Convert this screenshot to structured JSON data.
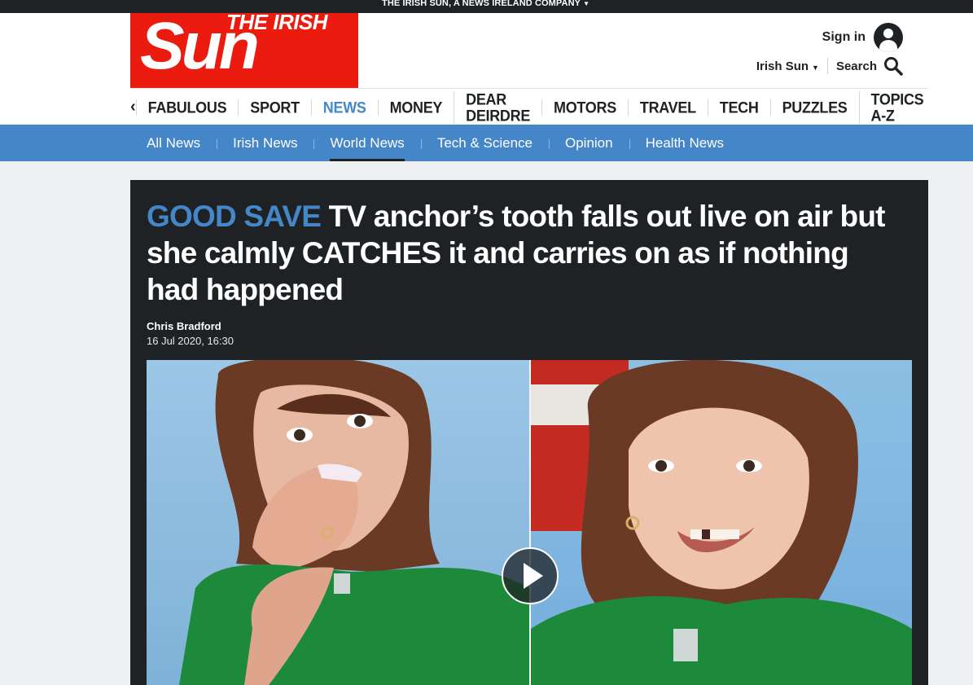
{
  "topbar": {
    "company": "THE IRISH SUN, A NEWS IRELAND COMPANY"
  },
  "logo": {
    "line1": "THE IRISH",
    "line2": "Sun"
  },
  "account": {
    "signin": "Sign in",
    "edition": "Irish Sun",
    "search": "Search"
  },
  "nav": {
    "items": [
      "FABULOUS",
      "SPORT",
      "NEWS",
      "MONEY",
      "DEAR DEIRDRE",
      "MOTORS",
      "TRAVEL",
      "TECH",
      "PUZZLES",
      "TOPICS A-Z"
    ],
    "active": "NEWS"
  },
  "subnav": {
    "items": [
      "All News",
      "Irish News",
      "World News",
      "Tech & Science",
      "Opinion",
      "Health News"
    ],
    "active": "World News"
  },
  "article": {
    "kicker": "GOOD SAVE",
    "headline": " TV anchor’s tooth falls out live on air but she calmly CATCHES it and carries on as if nothing had happened",
    "author": "Chris Bradford",
    "date": "16 Jul 2020, 16:30"
  },
  "colors": {
    "brand_red": "#eb1c0f",
    "accent_blue": "#4387c8",
    "dark": "#1e2225"
  },
  "icons": [
    "chevron-down-icon",
    "user-icon",
    "search-icon",
    "chevron-left-icon",
    "play-icon"
  ]
}
